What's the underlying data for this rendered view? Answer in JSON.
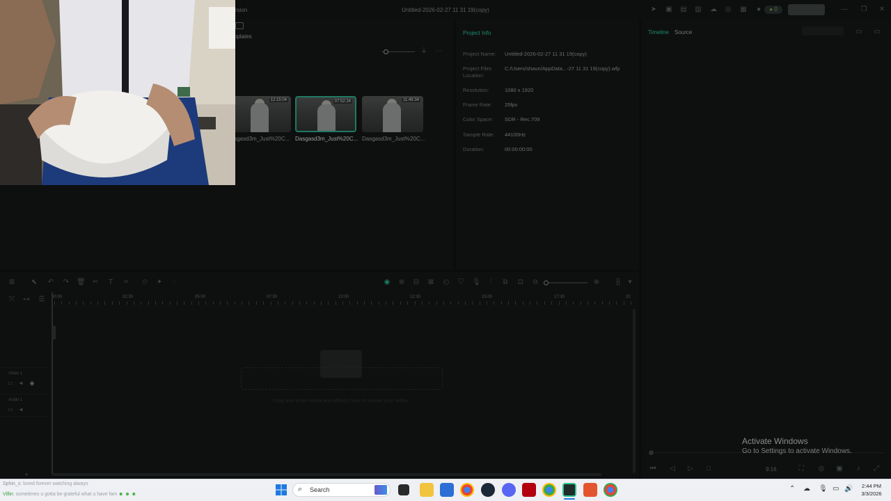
{
  "window": {
    "title": "Untitled-2026-02-27 11 31 19(copy)",
    "menu_fragment": "rsion",
    "credits_badge": "0"
  },
  "media": {
    "templates_label": "nplates",
    "clips": [
      {
        "name": "Dasgasd3m_Just%20C...",
        "duration": "12:15:04",
        "selected": false
      },
      {
        "name": "Dasgasd3m_Just%20C...",
        "duration": "07:52:24",
        "selected": true
      },
      {
        "name": "Dasgasd3m_Just%20C...",
        "duration": "11:49:34",
        "selected": false
      }
    ]
  },
  "project_info": {
    "heading": "Project Info",
    "fields": [
      {
        "label": "Project Name:",
        "value": "Untitled-2026-02-27 11 31 19(copy)"
      },
      {
        "label": "Project Files Location:",
        "value": "C:/Users/shaun/AppData...-27 11 31 19(copy).wfp"
      },
      {
        "label": "Resolution:",
        "value": "1080 x 1920"
      },
      {
        "label": "Frame Rate:",
        "value": "25fps"
      },
      {
        "label": "Color Space:",
        "value": "SDR - Rec.709"
      },
      {
        "label": "Sample Rate:",
        "value": "44100Hz"
      },
      {
        "label": "Duration:",
        "value": "00:00:00:00"
      }
    ]
  },
  "preview": {
    "tabs": [
      {
        "label": "Timeline",
        "active": true
      },
      {
        "label": "Source",
        "active": false
      }
    ],
    "aspect_ratio": "9:16"
  },
  "timeline": {
    "ruler": [
      "00:00",
      "02:30",
      "05:00",
      "07:30",
      "10:00",
      "12:30",
      "15:00",
      "17:30",
      "20"
    ],
    "tracks": [
      {
        "label": "Video 1"
      },
      {
        "label": "Audio 1"
      }
    ],
    "drop_hint": "Drag and drop media and effects here to create your video."
  },
  "watermark": {
    "line1": "Activate Windows",
    "line2": "Go to Settings to activate Windows."
  },
  "chat": [
    {
      "user": "Sphin_x",
      "message": ": loved forever watching always",
      "user_color": "#8a8f96"
    },
    {
      "user": "Villin",
      "message": ": sometimes u gotta be grateful what u have fam",
      "user_color": "#3c9a3c"
    }
  ],
  "taskbar": {
    "search_placeholder": "Search",
    "time": "2:44 PM",
    "date": "3/3/2026",
    "apps": [
      "windows-start",
      "widgets",
      "task-view",
      "file-explorer",
      "store",
      "chrome",
      "steam",
      "discord",
      "acrobat",
      "chrome-profile",
      "filmora",
      "app-red",
      "chrome-dev"
    ]
  }
}
